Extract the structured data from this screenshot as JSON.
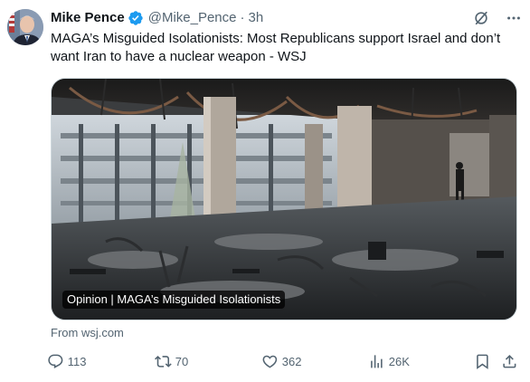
{
  "tweet": {
    "author_name": "Mike Pence",
    "handle": "@Mike_Pence",
    "separator": "·",
    "time": "3h",
    "text": "MAGA’s Misguided Isolationists: Most Republicans support Israel and don’t want Iran to have a nuclear weapon - WSJ",
    "card": {
      "label": "Opinion | MAGA’s Misguided Isolationists",
      "source": "From wsj.com"
    },
    "stats": {
      "replies": "113",
      "reposts": "70",
      "likes": "362",
      "views": "26K"
    }
  },
  "icons": {
    "verified": "verified-badge-icon",
    "grok": "grok-icon",
    "more": "more-icon",
    "reply": "reply-icon",
    "repost": "repost-icon",
    "like": "like-icon",
    "views": "views-icon",
    "bookmark": "bookmark-icon",
    "share": "share-icon"
  },
  "colors": {
    "text_primary": "#0f1419",
    "text_secondary": "#536471",
    "verified_blue": "#1d9bf0",
    "card_border": "#cfd9de"
  }
}
